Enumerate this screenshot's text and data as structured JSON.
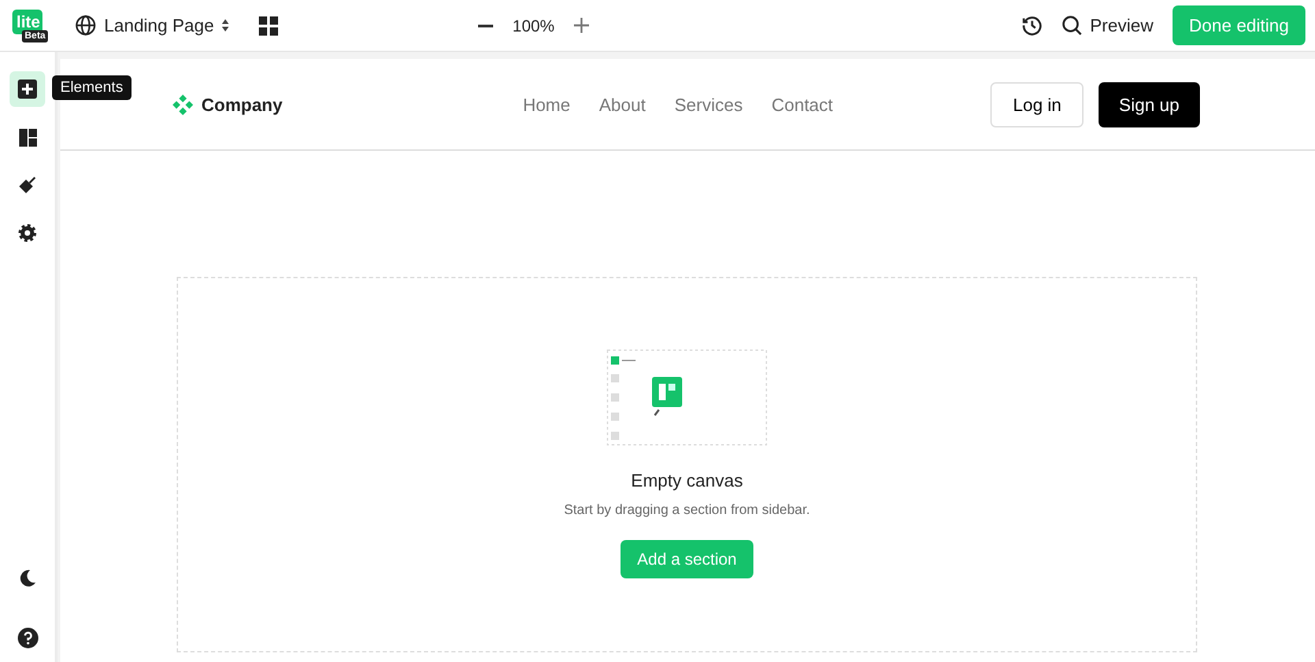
{
  "topbar": {
    "logo": "lite",
    "badge": "Beta",
    "page_name": "Landing Page",
    "zoom": "100%",
    "preview": "Preview",
    "done": "Done editing"
  },
  "sidebar": {
    "tools": [
      {
        "kind": "add",
        "selected": true
      },
      {
        "kind": "layout",
        "selected": false
      },
      {
        "kind": "paint",
        "selected": false
      },
      {
        "kind": "settings",
        "selected": false
      }
    ],
    "tooltip": "Elements"
  },
  "site": {
    "brand": "Company",
    "nav": [
      "Home",
      "About",
      "Services",
      "Contact"
    ],
    "login": "Log in",
    "signup": "Sign up"
  },
  "empty": {
    "title": "Empty canvas",
    "text": "Start by dragging a section from sidebar.",
    "button": "Add a section"
  }
}
